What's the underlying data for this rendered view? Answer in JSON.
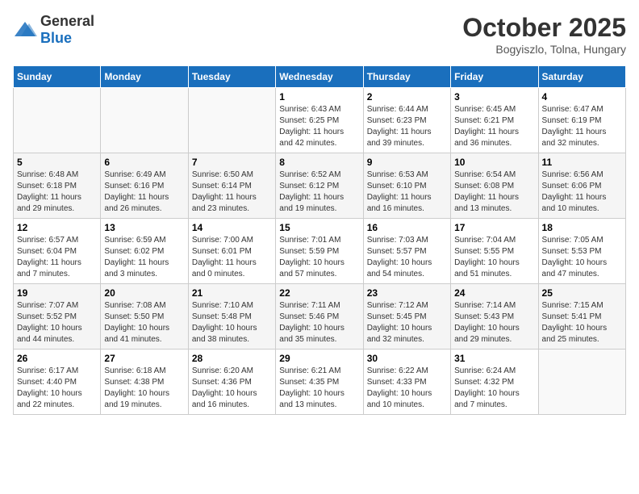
{
  "header": {
    "logo_general": "General",
    "logo_blue": "Blue",
    "month_title": "October 2025",
    "location": "Bogyiszlo, Tolna, Hungary"
  },
  "calendar": {
    "weekdays": [
      "Sunday",
      "Monday",
      "Tuesday",
      "Wednesday",
      "Thursday",
      "Friday",
      "Saturday"
    ],
    "weeks": [
      [
        {
          "day": "",
          "info": ""
        },
        {
          "day": "",
          "info": ""
        },
        {
          "day": "",
          "info": ""
        },
        {
          "day": "1",
          "info": "Sunrise: 6:43 AM\nSunset: 6:25 PM\nDaylight: 11 hours\nand 42 minutes."
        },
        {
          "day": "2",
          "info": "Sunrise: 6:44 AM\nSunset: 6:23 PM\nDaylight: 11 hours\nand 39 minutes."
        },
        {
          "day": "3",
          "info": "Sunrise: 6:45 AM\nSunset: 6:21 PM\nDaylight: 11 hours\nand 36 minutes."
        },
        {
          "day": "4",
          "info": "Sunrise: 6:47 AM\nSunset: 6:19 PM\nDaylight: 11 hours\nand 32 minutes."
        }
      ],
      [
        {
          "day": "5",
          "info": "Sunrise: 6:48 AM\nSunset: 6:18 PM\nDaylight: 11 hours\nand 29 minutes."
        },
        {
          "day": "6",
          "info": "Sunrise: 6:49 AM\nSunset: 6:16 PM\nDaylight: 11 hours\nand 26 minutes."
        },
        {
          "day": "7",
          "info": "Sunrise: 6:50 AM\nSunset: 6:14 PM\nDaylight: 11 hours\nand 23 minutes."
        },
        {
          "day": "8",
          "info": "Sunrise: 6:52 AM\nSunset: 6:12 PM\nDaylight: 11 hours\nand 19 minutes."
        },
        {
          "day": "9",
          "info": "Sunrise: 6:53 AM\nSunset: 6:10 PM\nDaylight: 11 hours\nand 16 minutes."
        },
        {
          "day": "10",
          "info": "Sunrise: 6:54 AM\nSunset: 6:08 PM\nDaylight: 11 hours\nand 13 minutes."
        },
        {
          "day": "11",
          "info": "Sunrise: 6:56 AM\nSunset: 6:06 PM\nDaylight: 11 hours\nand 10 minutes."
        }
      ],
      [
        {
          "day": "12",
          "info": "Sunrise: 6:57 AM\nSunset: 6:04 PM\nDaylight: 11 hours\nand 7 minutes."
        },
        {
          "day": "13",
          "info": "Sunrise: 6:59 AM\nSunset: 6:02 PM\nDaylight: 11 hours\nand 3 minutes."
        },
        {
          "day": "14",
          "info": "Sunrise: 7:00 AM\nSunset: 6:01 PM\nDaylight: 11 hours\nand 0 minutes."
        },
        {
          "day": "15",
          "info": "Sunrise: 7:01 AM\nSunset: 5:59 PM\nDaylight: 10 hours\nand 57 minutes."
        },
        {
          "day": "16",
          "info": "Sunrise: 7:03 AM\nSunset: 5:57 PM\nDaylight: 10 hours\nand 54 minutes."
        },
        {
          "day": "17",
          "info": "Sunrise: 7:04 AM\nSunset: 5:55 PM\nDaylight: 10 hours\nand 51 minutes."
        },
        {
          "day": "18",
          "info": "Sunrise: 7:05 AM\nSunset: 5:53 PM\nDaylight: 10 hours\nand 47 minutes."
        }
      ],
      [
        {
          "day": "19",
          "info": "Sunrise: 7:07 AM\nSunset: 5:52 PM\nDaylight: 10 hours\nand 44 minutes."
        },
        {
          "day": "20",
          "info": "Sunrise: 7:08 AM\nSunset: 5:50 PM\nDaylight: 10 hours\nand 41 minutes."
        },
        {
          "day": "21",
          "info": "Sunrise: 7:10 AM\nSunset: 5:48 PM\nDaylight: 10 hours\nand 38 minutes."
        },
        {
          "day": "22",
          "info": "Sunrise: 7:11 AM\nSunset: 5:46 PM\nDaylight: 10 hours\nand 35 minutes."
        },
        {
          "day": "23",
          "info": "Sunrise: 7:12 AM\nSunset: 5:45 PM\nDaylight: 10 hours\nand 32 minutes."
        },
        {
          "day": "24",
          "info": "Sunrise: 7:14 AM\nSunset: 5:43 PM\nDaylight: 10 hours\nand 29 minutes."
        },
        {
          "day": "25",
          "info": "Sunrise: 7:15 AM\nSunset: 5:41 PM\nDaylight: 10 hours\nand 25 minutes."
        }
      ],
      [
        {
          "day": "26",
          "info": "Sunrise: 6:17 AM\nSunset: 4:40 PM\nDaylight: 10 hours\nand 22 minutes."
        },
        {
          "day": "27",
          "info": "Sunrise: 6:18 AM\nSunset: 4:38 PM\nDaylight: 10 hours\nand 19 minutes."
        },
        {
          "day": "28",
          "info": "Sunrise: 6:20 AM\nSunset: 4:36 PM\nDaylight: 10 hours\nand 16 minutes."
        },
        {
          "day": "29",
          "info": "Sunrise: 6:21 AM\nSunset: 4:35 PM\nDaylight: 10 hours\nand 13 minutes."
        },
        {
          "day": "30",
          "info": "Sunrise: 6:22 AM\nSunset: 4:33 PM\nDaylight: 10 hours\nand 10 minutes."
        },
        {
          "day": "31",
          "info": "Sunrise: 6:24 AM\nSunset: 4:32 PM\nDaylight: 10 hours\nand 7 minutes."
        },
        {
          "day": "",
          "info": ""
        }
      ]
    ]
  }
}
